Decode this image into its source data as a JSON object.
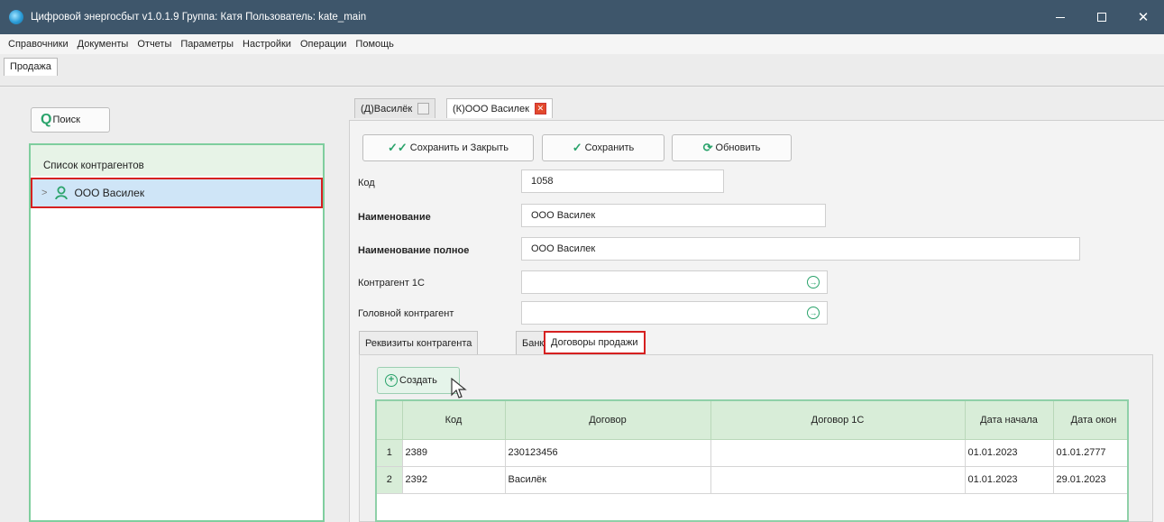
{
  "window": {
    "title": "Цифровой энергосбыт v1.0.1.9 Группа: Катя Пользователь: kate_main"
  },
  "menu": [
    "Справочники",
    "Документы",
    "Отчеты",
    "Параметры",
    "Настройки",
    "Операции",
    "Помощь"
  ],
  "top_tab": "Продажа",
  "left": {
    "search_label": "Поиск",
    "list_header": "Список контрагентов",
    "items": [
      {
        "label": "ООО Василек"
      }
    ]
  },
  "doc_tabs": [
    {
      "label": "(Д)Василёк"
    },
    {
      "label": "(К)ООО Василек"
    }
  ],
  "toolbar": {
    "save_close": "Сохранить и Закрыть",
    "save": "Сохранить",
    "refresh": "Обновить"
  },
  "form": {
    "code_label": "Код",
    "code_value": "1058",
    "name_label": "Наименование",
    "name_value": "ООО Василек",
    "fullname_label": "Наименование полное",
    "fullname_value": "ООО Василек",
    "c1_label": "Контрагент 1С",
    "c1_value": "",
    "head_label": "Головной контрагент",
    "head_value": ""
  },
  "sub_tabs": [
    "Реквизиты контрагента",
    "Банк",
    "Договоры продажи"
  ],
  "create_label": "Создать",
  "table": {
    "columns": [
      "Код",
      "Договор",
      "Договор 1С",
      "Дата начала",
      "Дата окон"
    ],
    "rows": [
      {
        "n": "1",
        "code": "2389",
        "contract": "230123456",
        "contract1c": "",
        "start": "01.01.2023",
        "end": "01.01.2777"
      },
      {
        "n": "2",
        "code": "2392",
        "contract": "Василёк",
        "contract1c": "",
        "start": "01.01.2023",
        "end": "29.01.2023"
      }
    ]
  },
  "colors": {
    "titlebar": "#3e566b",
    "accent_green": "#2aa36b",
    "highlight_red": "#d62020",
    "selection_blue": "#cfe5f7"
  }
}
